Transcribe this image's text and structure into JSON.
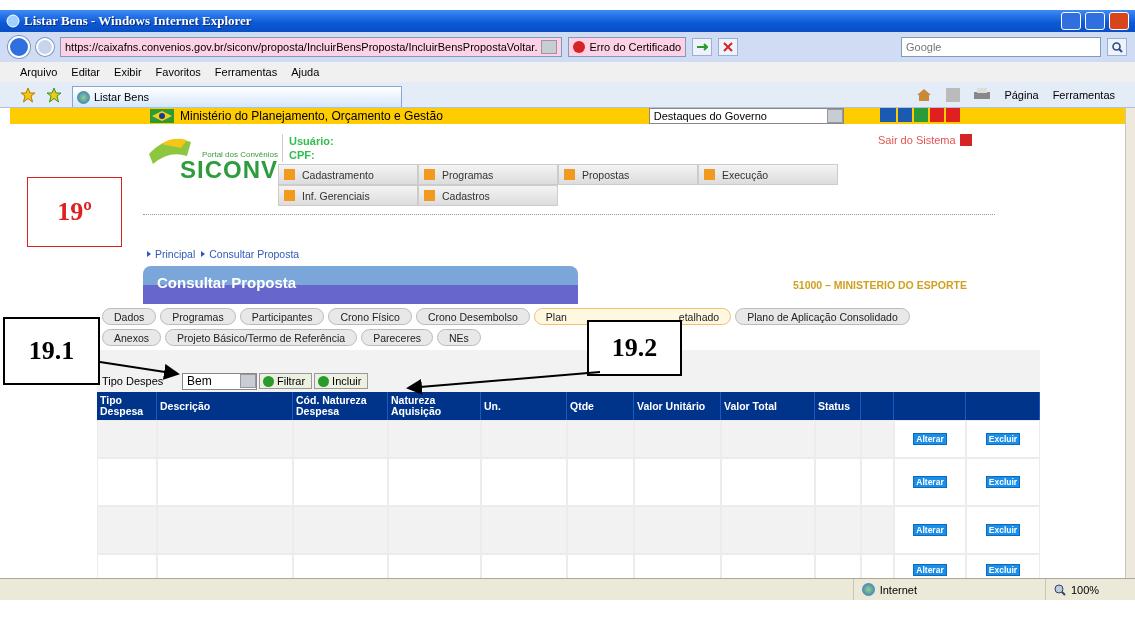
{
  "browser": {
    "title": "Listar Bens - Windows Internet Explorer",
    "address": "https://caixafns.convenios.gov.br/siconv/proposta/IncluirBensProposta/IncluirBensPropostaVoltar.",
    "cert_error": "Erro do Certificado",
    "search_placeholder": "Google",
    "menu": [
      "Arquivo",
      "Editar",
      "Exibir",
      "Favoritos",
      "Ferramentas",
      "Ajuda"
    ],
    "tab": "Listar Bens",
    "tools": [
      "Página",
      "Ferramentas"
    ],
    "status_zone": "Internet",
    "zoom": "100%"
  },
  "header": {
    "ministry": "Ministério do Planejamento, Orçamento e Gestão",
    "highlights": "Destaques do Governo",
    "portal": "Portal dos Convênios",
    "logo": "SICONV",
    "user_label": "Usuário:",
    "cpf_label": "CPF:",
    "logout": "Sair do Sistema"
  },
  "nav": [
    [
      "Cadastramento",
      "Programas",
      "Propostas",
      "Execução"
    ],
    [
      "Inf. Gerenciais",
      "Cadastros"
    ]
  ],
  "breadcrumb": [
    "Principal",
    "Consultar Proposta"
  ],
  "panel_title": "Consultar Proposta",
  "org": "51000 – MINISTERIO DO ESPORTE",
  "tabs": [
    [
      {
        "label": "Dados",
        "selected": false
      },
      {
        "label": "Programas",
        "selected": false
      },
      {
        "label": "Participantes",
        "selected": false
      },
      {
        "label": "Crono Físico",
        "selected": false
      },
      {
        "label": "Crono Desembolso",
        "selected": false
      },
      {
        "label": "Plan",
        "label_end": "etalhado",
        "selected": true
      },
      {
        "label": "Plano de Aplicação Consolidado",
        "selected": false
      }
    ],
    [
      {
        "label": "Anexos",
        "selected": false
      },
      {
        "label": "Projeto Básico/Termo de Referência",
        "selected": false
      },
      {
        "label": "Pareceres",
        "selected": false
      },
      {
        "label": "NEs",
        "selected": false
      }
    ]
  ],
  "filter": {
    "label": "Tipo Despes",
    "value": "Bem",
    "buttons": [
      "Filtrar",
      "Incluir"
    ]
  },
  "table": {
    "columns": [
      "Tipo Despesa",
      "Descrição",
      "Cód. Natureza Despesa",
      "Natureza Aquisição",
      "Un.",
      "Qtde",
      "Valor Unitário",
      "Valor Total",
      "Status"
    ],
    "rows": [
      {
        "actions": [
          "Alterar",
          "Excluir"
        ]
      },
      {
        "actions": [
          "Alterar",
          "Excluir"
        ]
      },
      {
        "actions": [
          "Alterar",
          "Excluir"
        ]
      },
      {
        "actions": [
          "Alterar",
          "Excluir"
        ]
      }
    ]
  },
  "annotations": [
    {
      "kind": "step",
      "text": "19º"
    },
    {
      "kind": "callout",
      "text": "19.1"
    },
    {
      "kind": "callout",
      "text": "19.2"
    }
  ]
}
